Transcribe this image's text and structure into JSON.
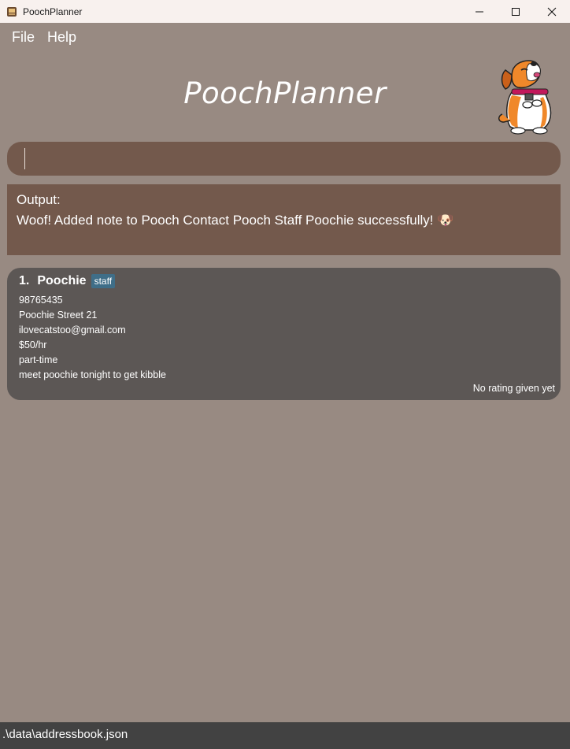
{
  "window": {
    "title": "PoochPlanner",
    "app_icon": "app-icon",
    "controls": [
      "minimize-icon",
      "maximize-icon",
      "close-icon"
    ]
  },
  "menu": {
    "file": "File",
    "help": "Help"
  },
  "header": {
    "title": "PoochPlanner",
    "mascot": "dog-mascot"
  },
  "command": {
    "value": "",
    "placeholder": ""
  },
  "output": {
    "label": "Output:",
    "message": "Woof! Added note to Pooch Contact Pooch Staff Poochie successfully! 🐶"
  },
  "contacts": [
    {
      "index": "1.",
      "name": "Poochie",
      "tag": "staff",
      "phone": "98765435",
      "address": "Poochie Street 21",
      "email": "ilovecatstoo@gmail.com",
      "salary": "$50/hr",
      "employment": "part-time",
      "note": "meet poochie tonight to get kibble",
      "rating": "No rating given yet"
    }
  ],
  "status": {
    "path": ".\\data\\addressbook.json"
  },
  "colors": {
    "background": "#988a82",
    "panel": "#73594c",
    "card": "#5c5755",
    "tag": "#3f6e88",
    "statusbar": "#424242"
  }
}
